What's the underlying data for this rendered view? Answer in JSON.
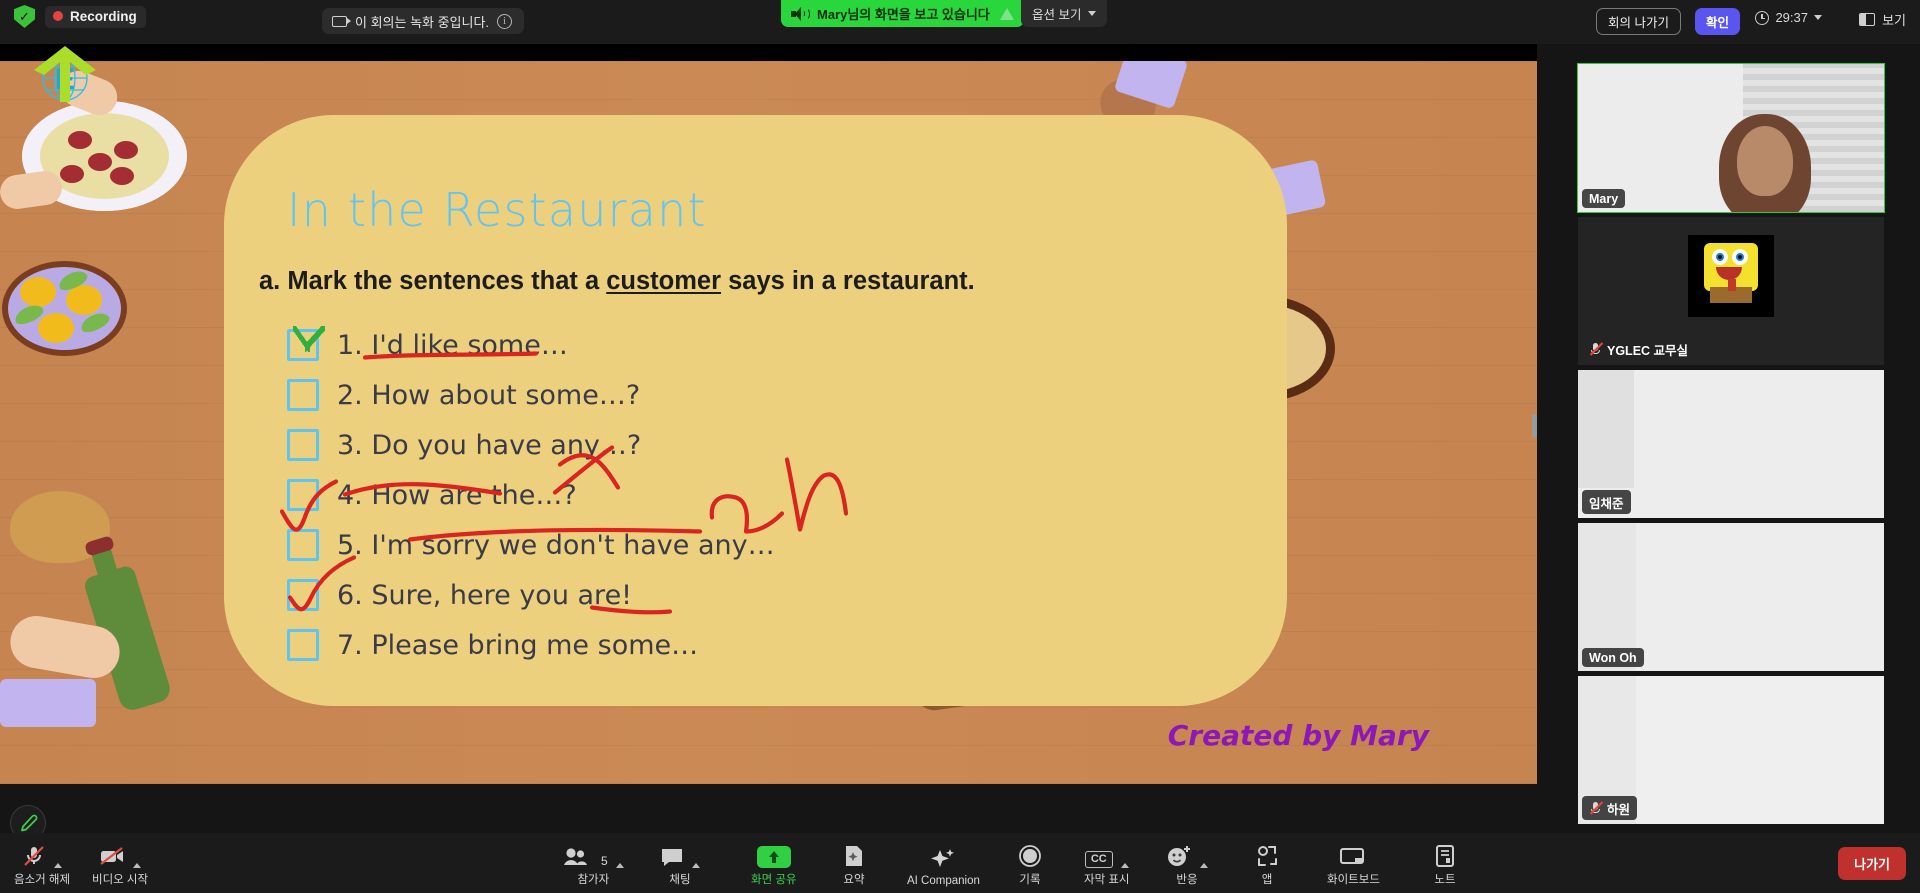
{
  "topbar": {
    "shield_icon": "shield-check-icon",
    "recording_label": "Recording",
    "recording_notice": "이 회의는 녹화 중입니다.",
    "notice_info_icon": "info-icon",
    "notice_cam_icon": "recording-camera-icon",
    "share_banner_text": "Mary님의 화면을 보고 있습니다",
    "share_banner_speaker_icon": "speaker-icon",
    "share_banner_color": "#29d63b",
    "view_options_label": "옵션 보기",
    "leave_meeting_label": "회의 나가기",
    "confirm_label": "확인",
    "timer": "29:37",
    "timer_icon": "clock-icon",
    "view_label": "보기",
    "view_icon": "layout-view-icon"
  },
  "slide": {
    "title": "In the Restaurant",
    "question_prefix": "a. Mark the sentences that a ",
    "question_underlined": "customer",
    "question_suffix": " says in a restaurant.",
    "items": [
      {
        "num": "1.",
        "text": "I'd like some…",
        "checked": true
      },
      {
        "num": "2.",
        "text": "How about some…?",
        "checked": false
      },
      {
        "num": "3.",
        "text": "Do you have any…?",
        "checked": false
      },
      {
        "num": "4.",
        "text": "How are the…?",
        "checked": false
      },
      {
        "num": "5.",
        "text": "I'm sorry we don't have any…",
        "checked": false
      },
      {
        "num": "6.",
        "text": "Sure, here you are!",
        "checked": false
      },
      {
        "num": "7.",
        "text": "Please bring me some…",
        "checked": false
      }
    ],
    "signature": "Created by Mary",
    "title_color": "#63c4ef",
    "card_color": "#edd07e",
    "annotation_color": "#d9241f"
  },
  "annotate_button": {
    "icon": "pencil-icon",
    "color": "#3ad24c"
  },
  "participants": [
    {
      "name": "Mary",
      "active": true,
      "muted": false,
      "kind": "video"
    },
    {
      "name": "YGLEC 교무실",
      "active": false,
      "muted": true,
      "kind": "avatar"
    },
    {
      "name": "임채준",
      "active": false,
      "muted": false,
      "kind": "camera-off"
    },
    {
      "name": "Won Oh",
      "active": false,
      "muted": false,
      "kind": "camera-off"
    },
    {
      "name": "하원",
      "active": false,
      "muted": true,
      "kind": "camera-off"
    }
  ],
  "toolbar": {
    "mute_label": "음소거 해제",
    "video_label": "비디오 시작",
    "participants_label": "참가자",
    "participants_count": "5",
    "chat_label": "채팅",
    "share_label": "화면 공유",
    "summary_label": "요약",
    "ai_companion_label": "AI Companion",
    "record_label": "기록",
    "captions_label": "자막 표시",
    "captions_badge": "CC",
    "reactions_label": "반응",
    "apps_label": "앱",
    "whiteboard_label": "화이트보드",
    "notes_label": "노트",
    "leave_label": "나가기",
    "leave_color": "#c0302c",
    "active_color": "#3ad24c"
  }
}
